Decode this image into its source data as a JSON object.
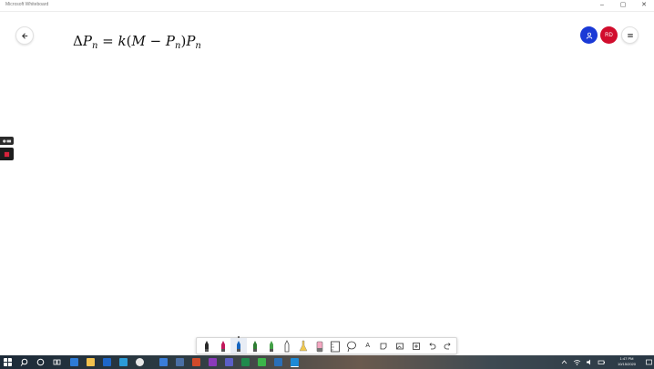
{
  "window": {
    "title": "Microsoft Whiteboard",
    "minimize": "–",
    "maximize": "▢",
    "close": "✕"
  },
  "header": {
    "profile_initials": "RD"
  },
  "canvas": {
    "formula": {
      "delta": "Δ",
      "p": "P",
      "n": "n",
      "equals": " = ",
      "k": "k",
      "open": "(",
      "m": "M",
      "minus": " − ",
      "close": ")"
    }
  },
  "toolbar": {
    "text_tool_label": "A",
    "tools": [
      "pen-black",
      "pen-red",
      "pen-blue",
      "pen-green",
      "pen-green-light",
      "pen-outline",
      "highlighter-yellow",
      "eraser",
      "ruler",
      "lasso",
      "text",
      "note",
      "image",
      "insert",
      "undo",
      "redo"
    ]
  },
  "taskbar": {
    "time": "1:47 PM",
    "date": "10/15/2020"
  },
  "colors": {
    "user_avatar": "#1a39d6",
    "profile_badge": "#d10d2d",
    "pen_black": "#2a2a2a",
    "pen_red": "#c2185b",
    "pen_blue": "#1565c0",
    "pen_green": "#2e7d32",
    "highlighter": "#f2c94c"
  }
}
